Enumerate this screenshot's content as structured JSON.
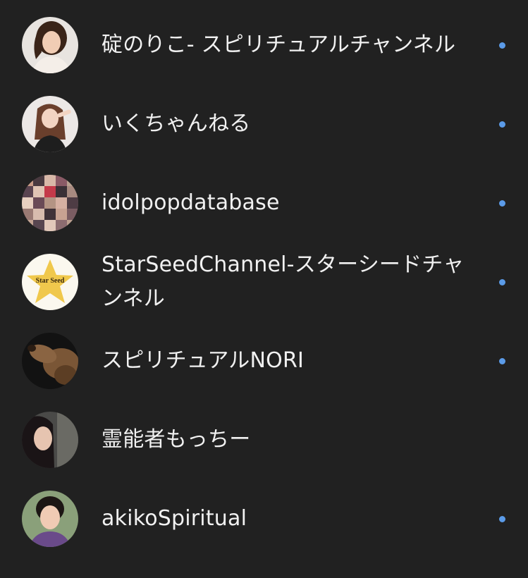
{
  "accent_dot_color": "#5b9be8",
  "channels": [
    {
      "name": "碇のりこ- スピリチュアルチャンネル",
      "avatar_icon": "woman-portrait-avatar",
      "has_new_content": true
    },
    {
      "name": "いくちゃんねる",
      "avatar_icon": "woman-long-hair-avatar",
      "has_new_content": true
    },
    {
      "name": "idolpopdatabase",
      "avatar_icon": "photo-collage-avatar",
      "has_new_content": true
    },
    {
      "name": "StarSeedChannel-スターシードチャンネル",
      "avatar_icon": "star-seed-logo-avatar",
      "avatar_text": "Star Seed",
      "has_new_content": true
    },
    {
      "name": "スピリチュアルNORI",
      "avatar_icon": "dog-avatar",
      "has_new_content": true
    },
    {
      "name": "霊能者もっちー",
      "avatar_icon": "woman-portrait-avatar",
      "has_new_content": false
    },
    {
      "name": "akikoSpiritual",
      "avatar_icon": "woman-smiling-avatar",
      "has_new_content": true
    }
  ]
}
